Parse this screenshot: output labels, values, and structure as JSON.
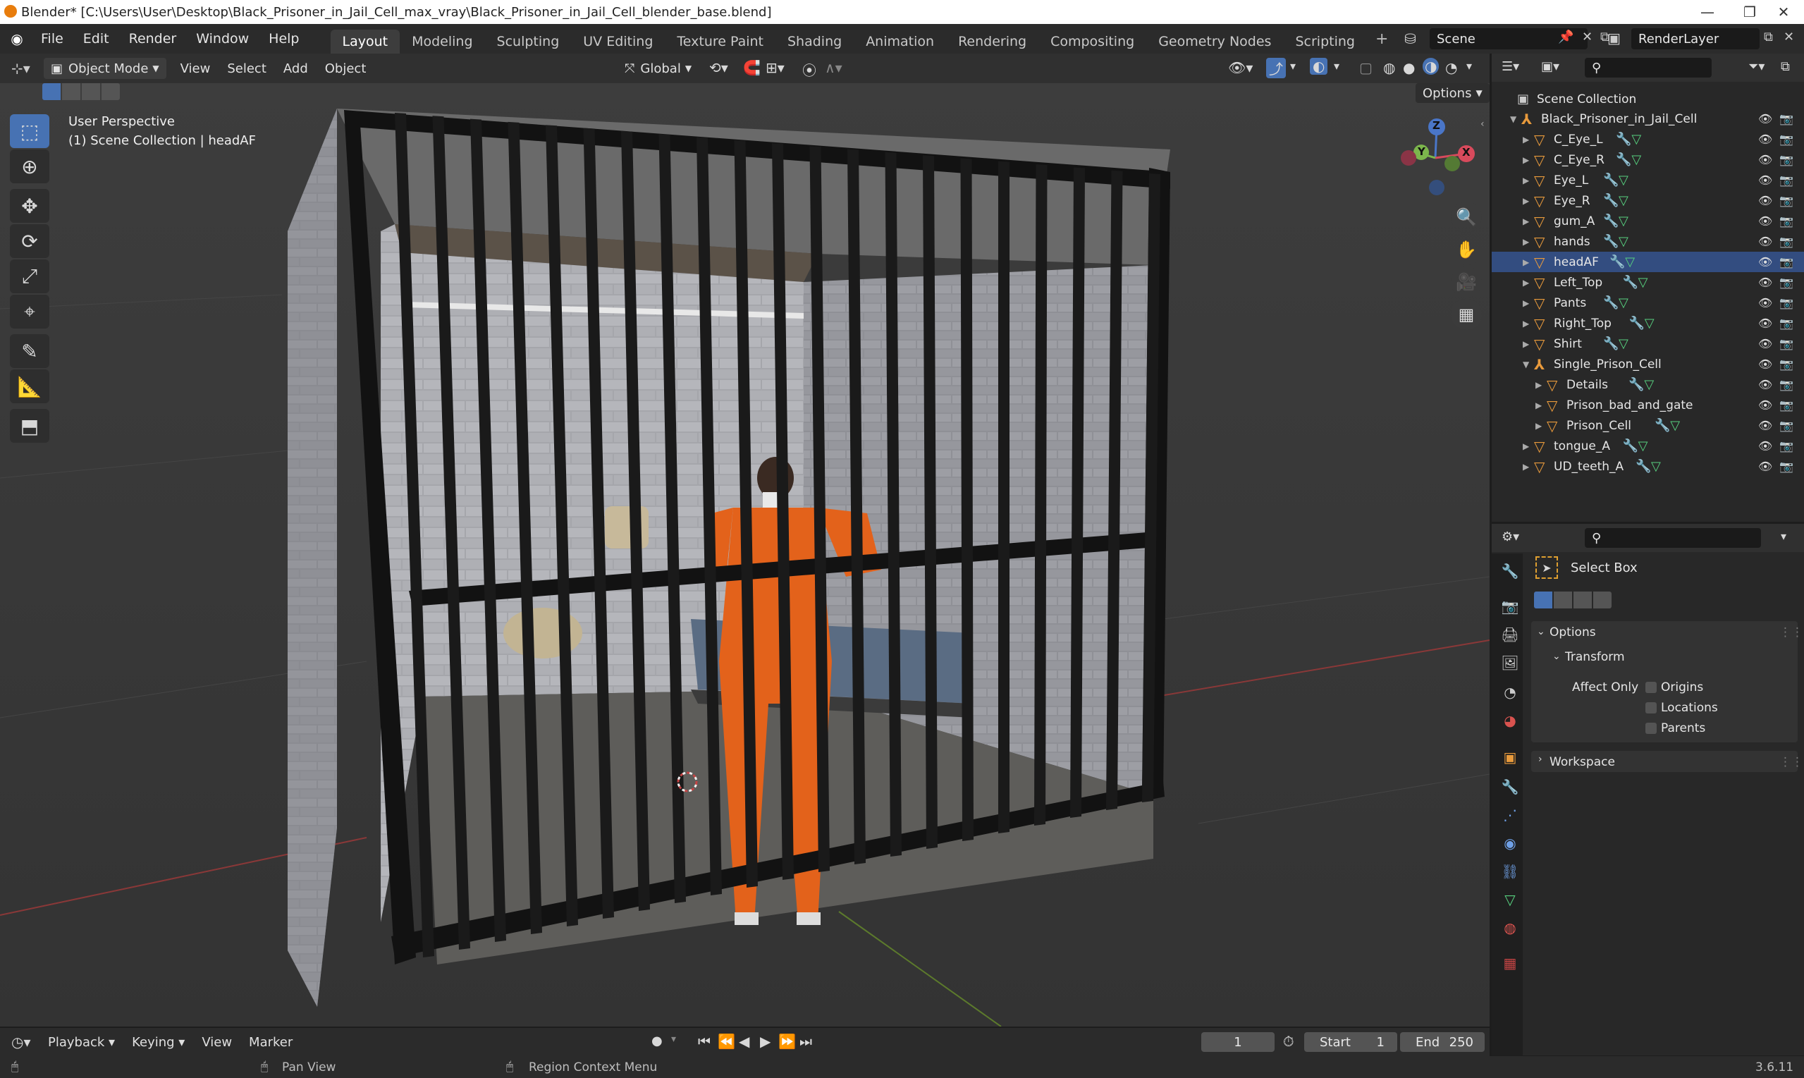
{
  "window": {
    "title": "Blender* [C:\\Users\\User\\Desktop\\Black_Prisoner_in_Jail_Cell_max_vray\\Black_Prisoner_in_Jail_Cell_blender_base.blend]",
    "minimize": "—",
    "maximize": "❐",
    "close": "✕"
  },
  "menu": [
    "File",
    "Edit",
    "Render",
    "Window",
    "Help"
  ],
  "workspaces": [
    {
      "label": "Layout",
      "active": true
    },
    {
      "label": "Modeling"
    },
    {
      "label": "Sculpting"
    },
    {
      "label": "UV Editing"
    },
    {
      "label": "Texture Paint"
    },
    {
      "label": "Shading"
    },
    {
      "label": "Animation"
    },
    {
      "label": "Rendering"
    },
    {
      "label": "Compositing"
    },
    {
      "label": "Geometry Nodes"
    },
    {
      "label": "Scripting"
    }
  ],
  "add_workspace": "+",
  "scene": {
    "name": "Scene",
    "render_layer": "RenderLayer"
  },
  "viewport_header": {
    "mode": "Object Mode",
    "menus": [
      "View",
      "Select",
      "Add",
      "Object"
    ],
    "orientation": "Global",
    "options": "Options"
  },
  "viewport": {
    "perspective": "User Perspective",
    "collection_info": "(1) Scene Collection | headAF",
    "gizmo": {
      "z": "Z",
      "y": "Y",
      "x": "X"
    }
  },
  "outliner": {
    "root": "Scene Collection",
    "items": [
      {
        "name": "Black_Prisoner_in_Jail_Cell",
        "depth": 0,
        "expanded": true,
        "type": "empty"
      },
      {
        "name": "C_Eye_L",
        "depth": 1,
        "type": "mesh"
      },
      {
        "name": "C_Eye_R",
        "depth": 1,
        "type": "mesh"
      },
      {
        "name": "Eye_L",
        "depth": 1,
        "type": "mesh"
      },
      {
        "name": "Eye_R",
        "depth": 1,
        "type": "mesh"
      },
      {
        "name": "gum_A",
        "depth": 1,
        "type": "mesh"
      },
      {
        "name": "hands",
        "depth": 1,
        "type": "mesh"
      },
      {
        "name": "headAF",
        "depth": 1,
        "type": "mesh",
        "active": true
      },
      {
        "name": "Left_Top",
        "depth": 1,
        "type": "mesh"
      },
      {
        "name": "Pants",
        "depth": 1,
        "type": "mesh"
      },
      {
        "name": "Right_Top",
        "depth": 1,
        "type": "mesh"
      },
      {
        "name": "Shirt",
        "depth": 1,
        "type": "mesh"
      },
      {
        "name": "Single_Prison_Cell",
        "depth": 1,
        "expanded": true,
        "type": "empty"
      },
      {
        "name": "Details",
        "depth": 2,
        "type": "mesh"
      },
      {
        "name": "Prison_bad_and_gate",
        "depth": 2,
        "type": "mesh",
        "no_mod": true
      },
      {
        "name": "Prison_Cell",
        "depth": 2,
        "type": "mesh"
      },
      {
        "name": "tongue_A",
        "depth": 1,
        "type": "mesh"
      },
      {
        "name": "UD_teeth_A",
        "depth": 1,
        "type": "mesh"
      }
    ]
  },
  "properties": {
    "tool_name": "Select Box",
    "options_label": "Options",
    "transform_label": "Transform",
    "affect_only_label": "Affect Only",
    "checkboxes": [
      "Origins",
      "Locations",
      "Parents"
    ],
    "workspace_label": "Workspace"
  },
  "timeline": {
    "menus": [
      "Playback",
      "Keying",
      "View",
      "Marker"
    ],
    "current_frame": "1",
    "start_label": "Start",
    "start": "1",
    "end_label": "End",
    "end": "250"
  },
  "status": {
    "pan_view": "Pan View",
    "context_menu": "Region Context Menu",
    "version": "3.6.11"
  },
  "colors": {
    "accent": "#4772b3",
    "object_orange": "#e89a3c",
    "modifier_blue": "#6fa0e6",
    "mesh_green": "#57d17f"
  }
}
